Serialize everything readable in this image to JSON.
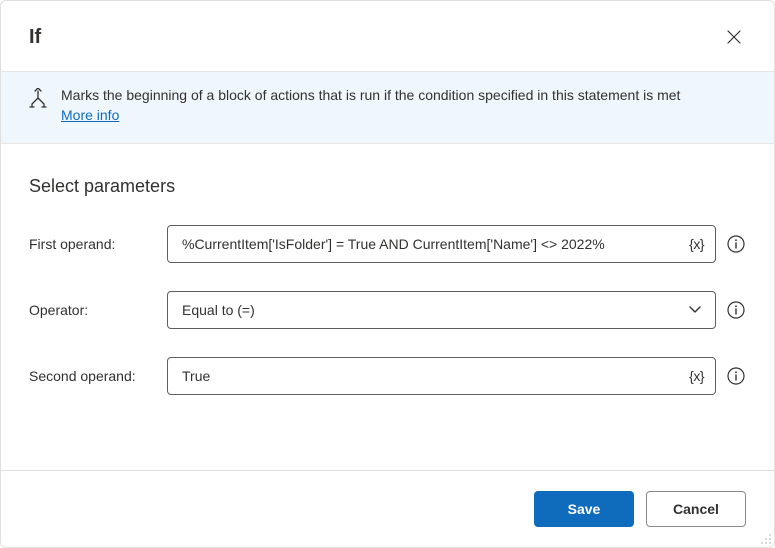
{
  "header": {
    "title": "If"
  },
  "info": {
    "description": "Marks the beginning of a block of actions that is run if the condition specified in this statement is met",
    "link_label": "More info"
  },
  "section_title": "Select parameters",
  "fields": {
    "first_operand": {
      "label": "First operand:",
      "value": "%CurrentItem['IsFolder'] = True AND CurrentItem['Name'] <> 2022%"
    },
    "operator": {
      "label": "Operator:",
      "value": "Equal to (=)"
    },
    "second_operand": {
      "label": "Second operand:",
      "value": "True"
    }
  },
  "var_token": "{x}",
  "buttons": {
    "save": "Save",
    "cancel": "Cancel"
  }
}
